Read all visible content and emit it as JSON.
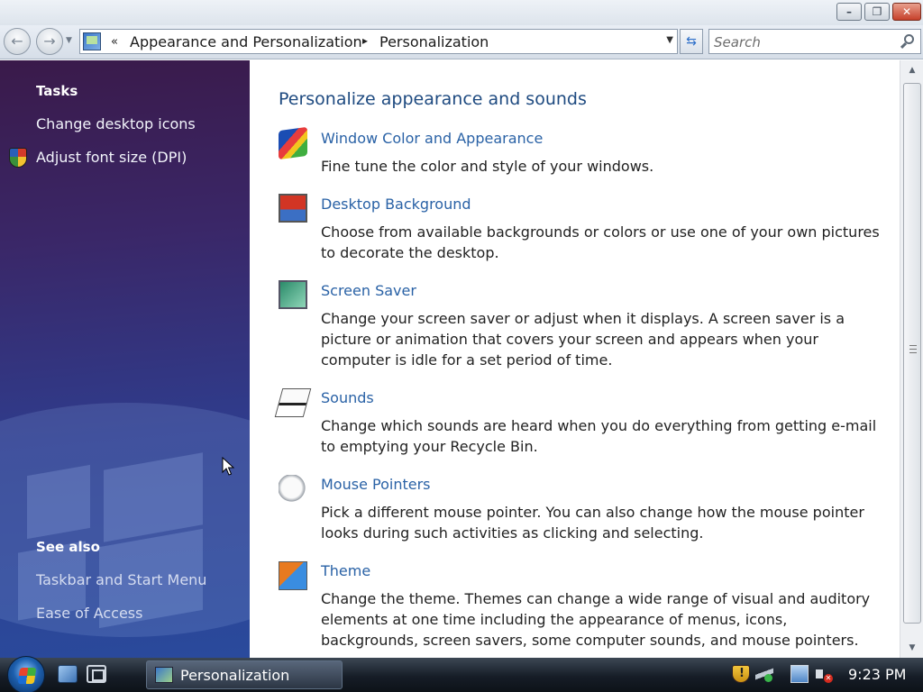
{
  "address_bar": {
    "overflow_glyph": "«",
    "breadcrumb": [
      "Appearance and Personalization",
      "Personalization"
    ],
    "separator": "▸",
    "search_placeholder": "Search"
  },
  "left_pane": {
    "tasks_heading": "Tasks",
    "tasks": [
      {
        "label": "Change desktop icons",
        "has_shield": false
      },
      {
        "label": "Adjust font size (DPI)",
        "has_shield": true
      }
    ],
    "see_also_heading": "See also",
    "see_also": [
      "Taskbar and Start Menu",
      "Ease of Access"
    ]
  },
  "main": {
    "title": "Personalize appearance and sounds",
    "items": [
      {
        "icon": "window-color-icon",
        "title": "Window Color and Appearance",
        "description": "Fine tune the color and style of your windows."
      },
      {
        "icon": "desktop-background-icon",
        "title": "Desktop Background",
        "description": "Choose from available backgrounds or colors or use one of your own pictures to decorate the desktop."
      },
      {
        "icon": "screen-saver-icon",
        "title": "Screen Saver",
        "description": "Change your screen saver or adjust when it displays. A screen saver is a picture or animation that covers your screen and appears when your computer is idle for a set period of time."
      },
      {
        "icon": "sounds-icon",
        "title": "Sounds",
        "description": "Change which sounds are heard when you do everything from getting e-mail to emptying your Recycle Bin."
      },
      {
        "icon": "mouse-pointers-icon",
        "title": "Mouse Pointers",
        "description": "Pick a different mouse pointer. You can also change how the mouse pointer looks during such activities as clicking and selecting."
      },
      {
        "icon": "theme-icon",
        "title": "Theme",
        "description": "Change the theme. Themes can change a wide range of visual and auditory elements at one time including the appearance of menus, icons, backgrounds, screen savers, some computer sounds, and mouse pointers."
      }
    ]
  },
  "taskbar": {
    "task_label": "Personalization",
    "clock": "9:23 PM"
  },
  "colors": {
    "link": "#2a62a6",
    "heading": "#1e4a80",
    "left_pane": "#2f3c8c"
  }
}
